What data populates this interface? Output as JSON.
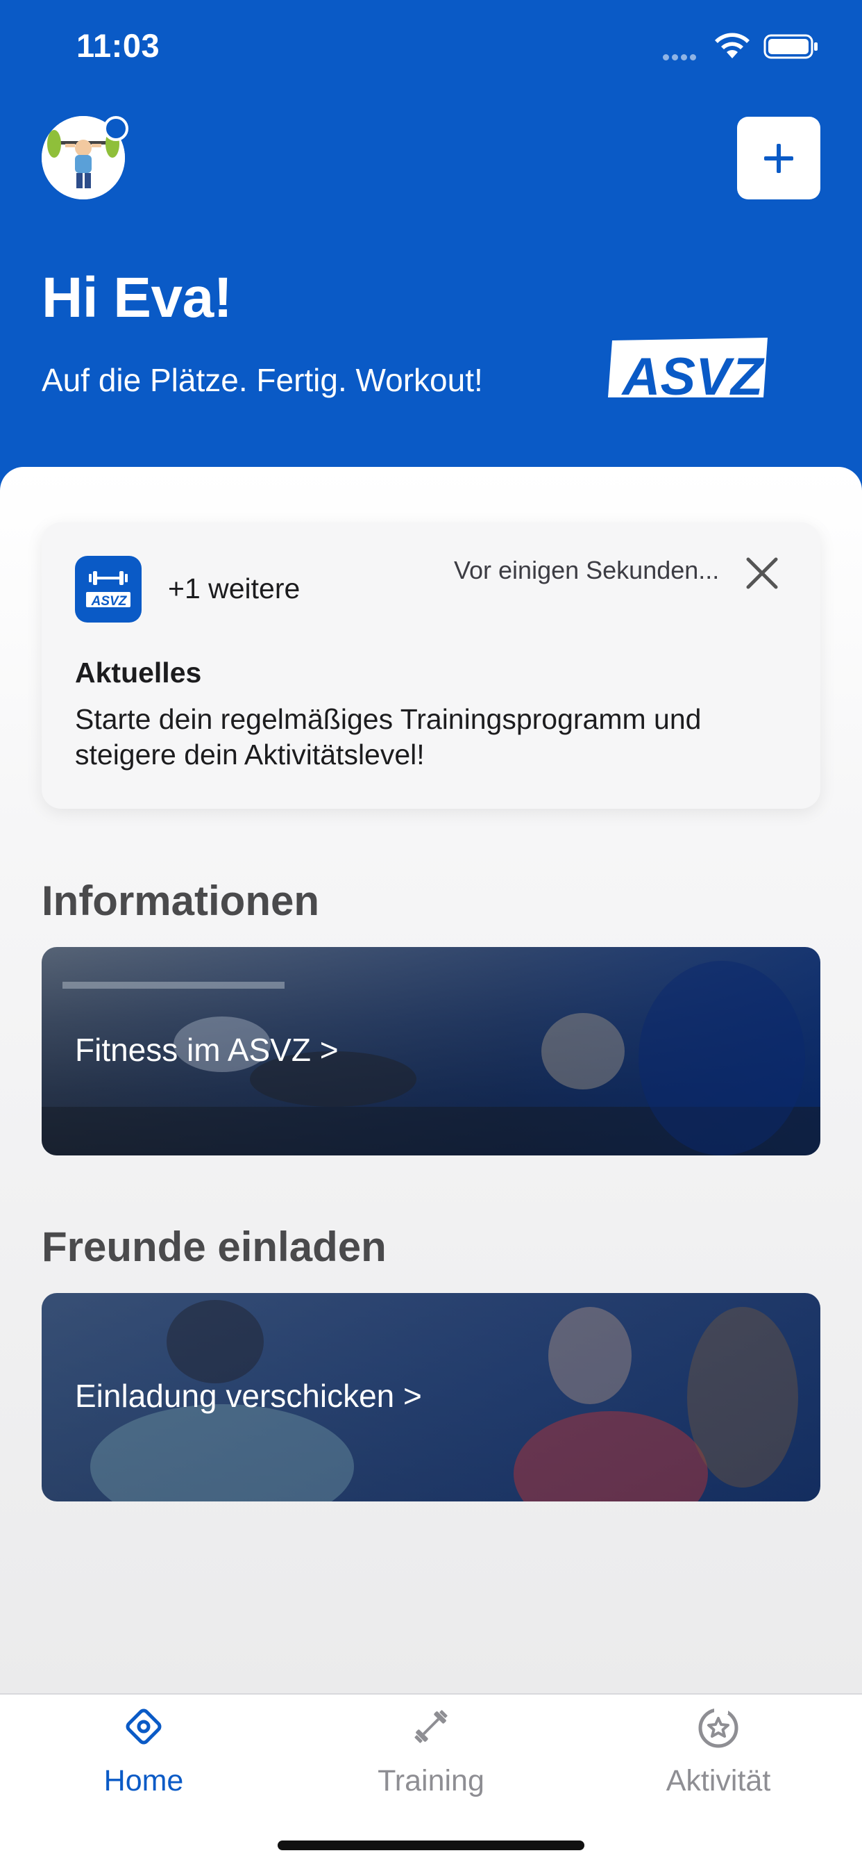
{
  "status_bar": {
    "time": "11:03"
  },
  "header": {
    "greeting": "Hi Eva!",
    "subtitle": "Auf die Plätze. Fertig. Workout!",
    "logo_text": "ASVZ",
    "add_icon": "plus-icon"
  },
  "notification": {
    "more": "+1 weitere",
    "time": "Vor einigen Sekunden...",
    "title": "Aktuelles",
    "body": "Starte dein regelmäßiges Trainingsprogramm und steigere dein Aktivitätslevel!",
    "icon_text": "ASVZ",
    "close_icon": "close-icon"
  },
  "sections": {
    "info_title": "Informationen",
    "info_card": "Fitness im ASVZ >",
    "invite_title": "Freunde einladen",
    "invite_card": "Einladung verschicken >"
  },
  "tabbar": {
    "items": [
      {
        "label": "Home",
        "icon": "home-icon",
        "active": true
      },
      {
        "label": "Training",
        "icon": "dumbbell-icon",
        "active": false
      },
      {
        "label": "Aktivität",
        "icon": "star-badge-icon",
        "active": false
      }
    ]
  },
  "colors": {
    "brand": "#0a5ac6",
    "inactive": "#8e8e93"
  }
}
